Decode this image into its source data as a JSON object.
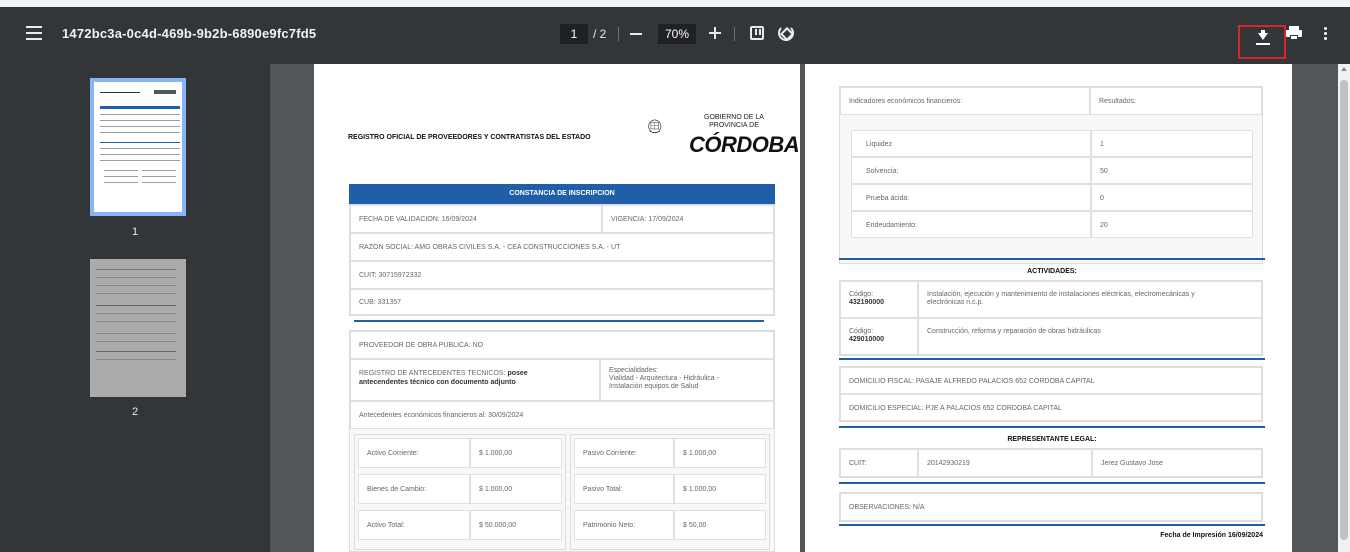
{
  "toolbar": {
    "doc_title": "1472bc3a-0c4d-469b-9b2b-6890e9fc7fd5",
    "page_current": "1",
    "page_sep": "/ 2",
    "zoom": "70%"
  },
  "sidebar": {
    "thumbs": [
      {
        "num": "1"
      },
      {
        "num": "2"
      }
    ]
  },
  "page1": {
    "header_title": "REGISTRO OFICIAL DE PROVEEDORES Y CONTRATISTAS DEL ESTADO",
    "logo_gov": [
      "GOBIERNO DE LA",
      "PROVINCIA DE"
    ],
    "logo_name": "CÓRDOBA",
    "constancia": "CONSTANCIA DE INSCRIPCION",
    "fecha_validacion": "FECHA DE VALIDACION: 16/09/2024",
    "vigencia": "VIGENCIA: 17/09/2024",
    "razon_social": "RAZON SOCIAL: AMG OBRAS CIVILES S.A. - CEA CONSTRUCCIONES S.A. - UT",
    "cuit": "CUIT: 30715972332",
    "cub": "CUB: 331357",
    "proveedor": "PROVEEDOR DE OBRA PUBLICA: NO",
    "registro_label": "REGISTRO DE ANTECEDENTES TECNICOS:",
    "registro_value_1": "posee",
    "registro_value_2": "antecendentes técnico con documento adjunto",
    "especialidades_label": "Especialidades:",
    "especialidades_1": "Vialidad - Arquitectura - Hidráulica -",
    "especialidades_2": "Instalación equipos de Salud",
    "antecedentes": "Antecedentes económicos financieros al: 30/09/2024",
    "left_table": [
      {
        "label": "Activo Corriente:",
        "value": "$ 1.000,00"
      },
      {
        "label": "Bienes de Cambio:",
        "value": "$ 1.000,00"
      },
      {
        "label": "Activo Total:",
        "value": "$ 50.000,00"
      }
    ],
    "right_table": [
      {
        "label": "Pasivo Corriente:",
        "value": "$ 1.000,00"
      },
      {
        "label": "Pasivo Total:",
        "value": "$ 1.000,00"
      },
      {
        "label": "Patrimonio Neto:",
        "value": "$ 50,00"
      }
    ]
  },
  "page2": {
    "indicadores_head": "Indicadores económicos financieros:",
    "resultados_head": "Resultados:",
    "indicadores": [
      {
        "label": "Liquidez",
        "value": "1"
      },
      {
        "label": "Solvencia:",
        "value": "50"
      },
      {
        "label": "Prueba ácida:",
        "value": "0"
      },
      {
        "label": "Endeudamiento:",
        "value": "20"
      }
    ],
    "actividades_title": "ACTIVIDADES:",
    "actividades": [
      {
        "codigo_label": "Código:",
        "codigo": "432190000",
        "desc1": "Instalación, ejecución y mantenimiento de instalaciones eléctricas, electromecánicas y",
        "desc2": "electrónicas n.c.p."
      },
      {
        "codigo_label": "Código:",
        "codigo": "429010000",
        "desc1": "Construcción, reforma y reparación de obras hidráulicas",
        "desc2": ""
      }
    ],
    "domicilio_fiscal": "DOMICILIO FISCAL: PASAJE ALFREDO PALACIOS 652 CORDOBA CAPITAL",
    "domicilio_especial": "DOMICILIO ESPECIAL: PJE A PALACIOS 652 CORDOBA CAPITAL",
    "representante_title": "REPRESENTANTE LEGAL:",
    "rep_cuit_label": "CUIT:",
    "rep_cuit": "20142930219",
    "rep_name": "Jerez Gustavo Jose",
    "observaciones": "OBSERVACIONES: N/A",
    "fecha_impresion": "Fecha de Impresión 16/09/2024"
  }
}
